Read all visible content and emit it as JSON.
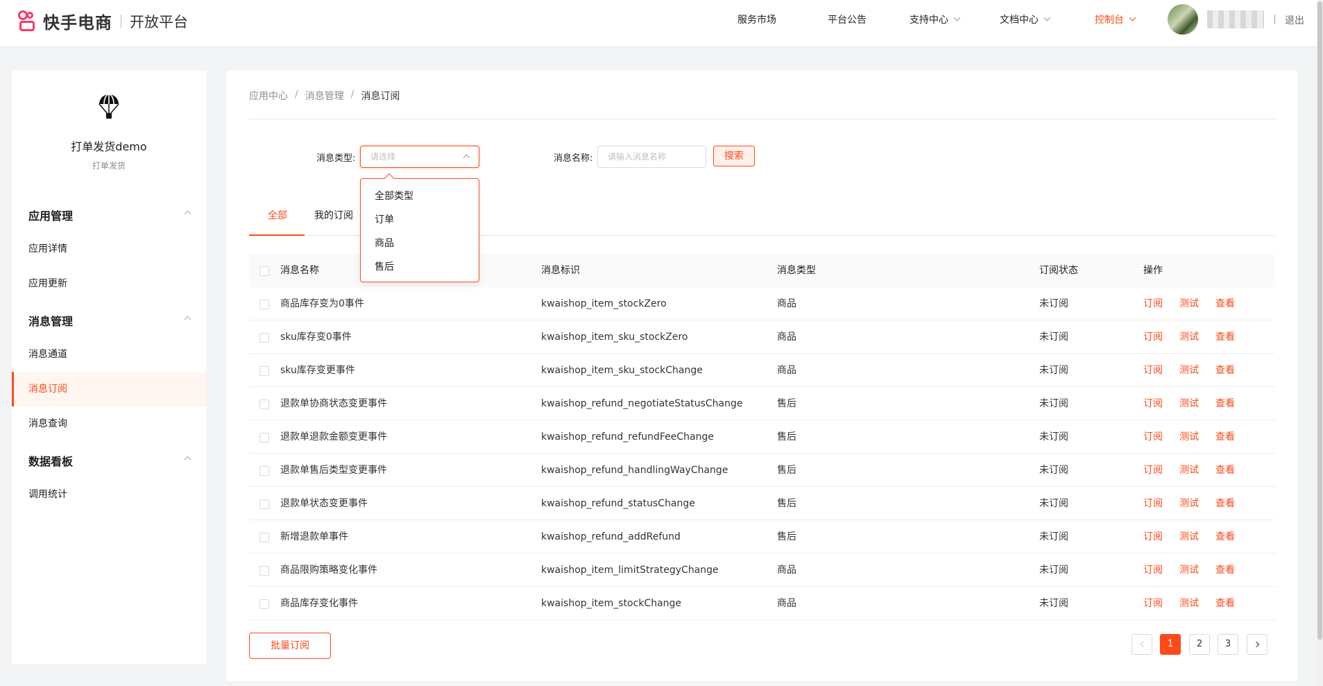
{
  "header": {
    "brand": "快手电商",
    "platform": "开放平台",
    "nav": [
      {
        "label": "服务市场",
        "dropdown": false,
        "active": false
      },
      {
        "label": "平台公告",
        "dropdown": false,
        "active": false
      },
      {
        "label": "支持中心",
        "dropdown": true,
        "active": false
      },
      {
        "label": "文档中心",
        "dropdown": true,
        "active": false
      },
      {
        "label": "控制台",
        "dropdown": true,
        "active": true
      }
    ],
    "logout": "退出"
  },
  "sidebar": {
    "app_name": "打单发货demo",
    "app_sub": "打单发货",
    "groups": [
      {
        "title": "应用管理",
        "items": [
          "应用详情",
          "应用更新"
        ]
      },
      {
        "title": "消息管理",
        "items": [
          "消息通道",
          "消息订阅",
          "消息查询"
        ]
      },
      {
        "title": "数据看板",
        "items": [
          "调用统计"
        ]
      }
    ],
    "active_item": "消息订阅"
  },
  "breadcrumb": [
    "应用中心",
    "消息管理",
    "消息订阅"
  ],
  "filters": {
    "type_label": "消息类型:",
    "type_placeholder": "请选择",
    "type_options": [
      "全部类型",
      "订单",
      "商品",
      "售后"
    ],
    "name_label": "消息名称:",
    "name_placeholder": "请输入消息名称",
    "search_label": "搜索"
  },
  "tabs": [
    {
      "label": "全部",
      "active": true
    },
    {
      "label": "我的订阅",
      "active": false
    }
  ],
  "table": {
    "columns": [
      "消息名称",
      "消息标识",
      "消息类型",
      "订阅状态",
      "操作"
    ],
    "actions": [
      "订阅",
      "测试",
      "查看"
    ],
    "rows": [
      {
        "name": "商品库存变为0事件",
        "id": "kwaishop_item_stockZero",
        "type": "商品",
        "status": "未订阅"
      },
      {
        "name": "sku库存变0事件",
        "id": "kwaishop_item_sku_stockZero",
        "type": "商品",
        "status": "未订阅"
      },
      {
        "name": "sku库存变更事件",
        "id": "kwaishop_item_sku_stockChange",
        "type": "商品",
        "status": "未订阅"
      },
      {
        "name": "退款单协商状态变更事件",
        "id": "kwaishop_refund_negotiateStatusChange",
        "type": "售后",
        "status": "未订阅"
      },
      {
        "name": "退款单退款金额变更事件",
        "id": "kwaishop_refund_refundFeeChange",
        "type": "售后",
        "status": "未订阅"
      },
      {
        "name": "退款单售后类型变更事件",
        "id": "kwaishop_refund_handlingWayChange",
        "type": "售后",
        "status": "未订阅"
      },
      {
        "name": "退款单状态变更事件",
        "id": "kwaishop_refund_statusChange",
        "type": "售后",
        "status": "未订阅"
      },
      {
        "name": "新增退款单事件",
        "id": "kwaishop_refund_addRefund",
        "type": "售后",
        "status": "未订阅"
      },
      {
        "name": "商品限购策略变化事件",
        "id": "kwaishop_item_limitStrategyChange",
        "type": "商品",
        "status": "未订阅"
      },
      {
        "name": "商品库存变化事件",
        "id": "kwaishop_item_stockChange",
        "type": "商品",
        "status": "未订阅"
      }
    ]
  },
  "batch_button": "批量订阅",
  "pagination": {
    "pages": [
      "1",
      "2",
      "3"
    ],
    "current": "1"
  },
  "colors": {
    "accent": "#fe4a19",
    "logo": "#fe3666"
  }
}
